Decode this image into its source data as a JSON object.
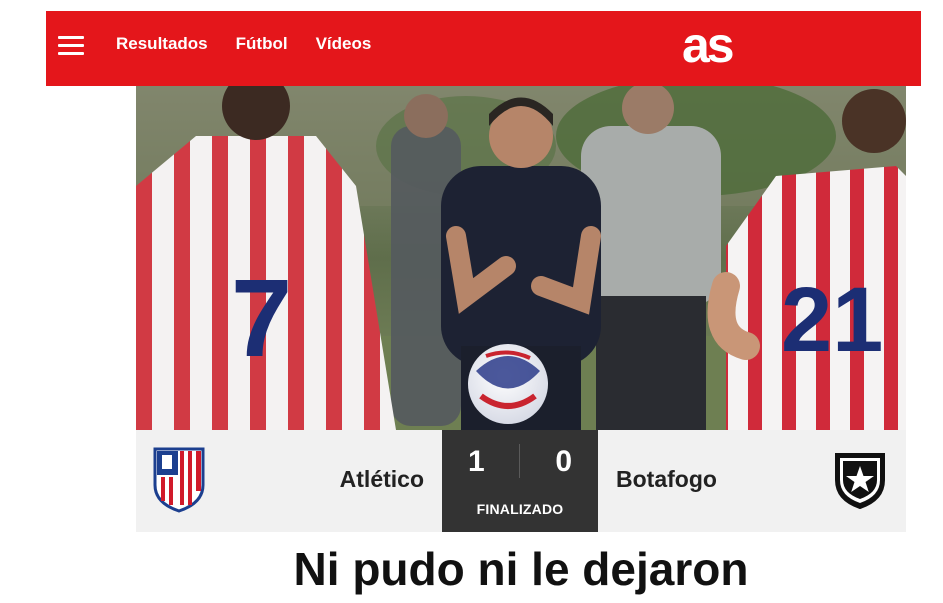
{
  "header": {
    "nav": [
      "Resultados",
      "Fútbol",
      "Vídeos"
    ],
    "logo": "as",
    "brand_color": "#e4161b"
  },
  "hero": {
    "jersey_numbers": [
      "7",
      "21"
    ]
  },
  "match": {
    "home_team": "Atlético",
    "away_team": "Botafogo",
    "home_score": "1",
    "away_score": "0",
    "status": "FINALIZADO",
    "home_crest_icon": "atletico-madrid-crest-icon",
    "away_crest_icon": "botafogo-crest-icon"
  },
  "article": {
    "headline": "Ni pudo ni le dejaron"
  }
}
